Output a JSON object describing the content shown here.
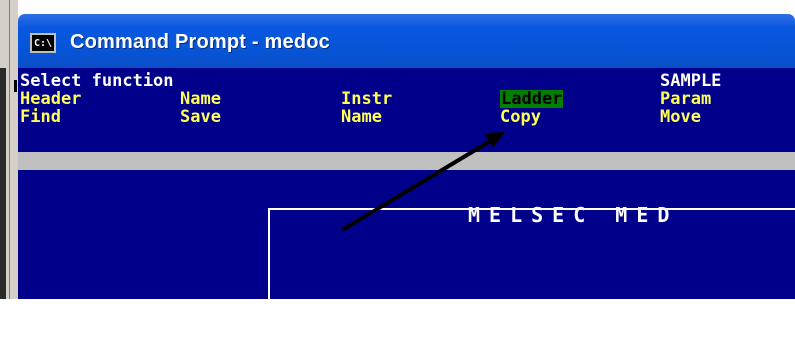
{
  "window": {
    "title": "Command Prompt - medoc",
    "icon_text": "C:\\"
  },
  "console": {
    "line1": {
      "left": "Select function",
      "right": "SAMPLE"
    },
    "menu_row1": [
      "Header",
      "Name",
      "Instr",
      "Ladder",
      "Param"
    ],
    "menu_row2": [
      "Find",
      "Save",
      "Name",
      "Copy",
      "Move"
    ],
    "selected_item": "Ladder",
    "banner": "MELSEC MED"
  },
  "colors": {
    "console_bg": "#00008b",
    "menu_text": "#ffff55",
    "highlight_bg": "#008000",
    "titlebar": "#0654d6"
  },
  "annotation": {
    "icon": "arrow-icon"
  }
}
